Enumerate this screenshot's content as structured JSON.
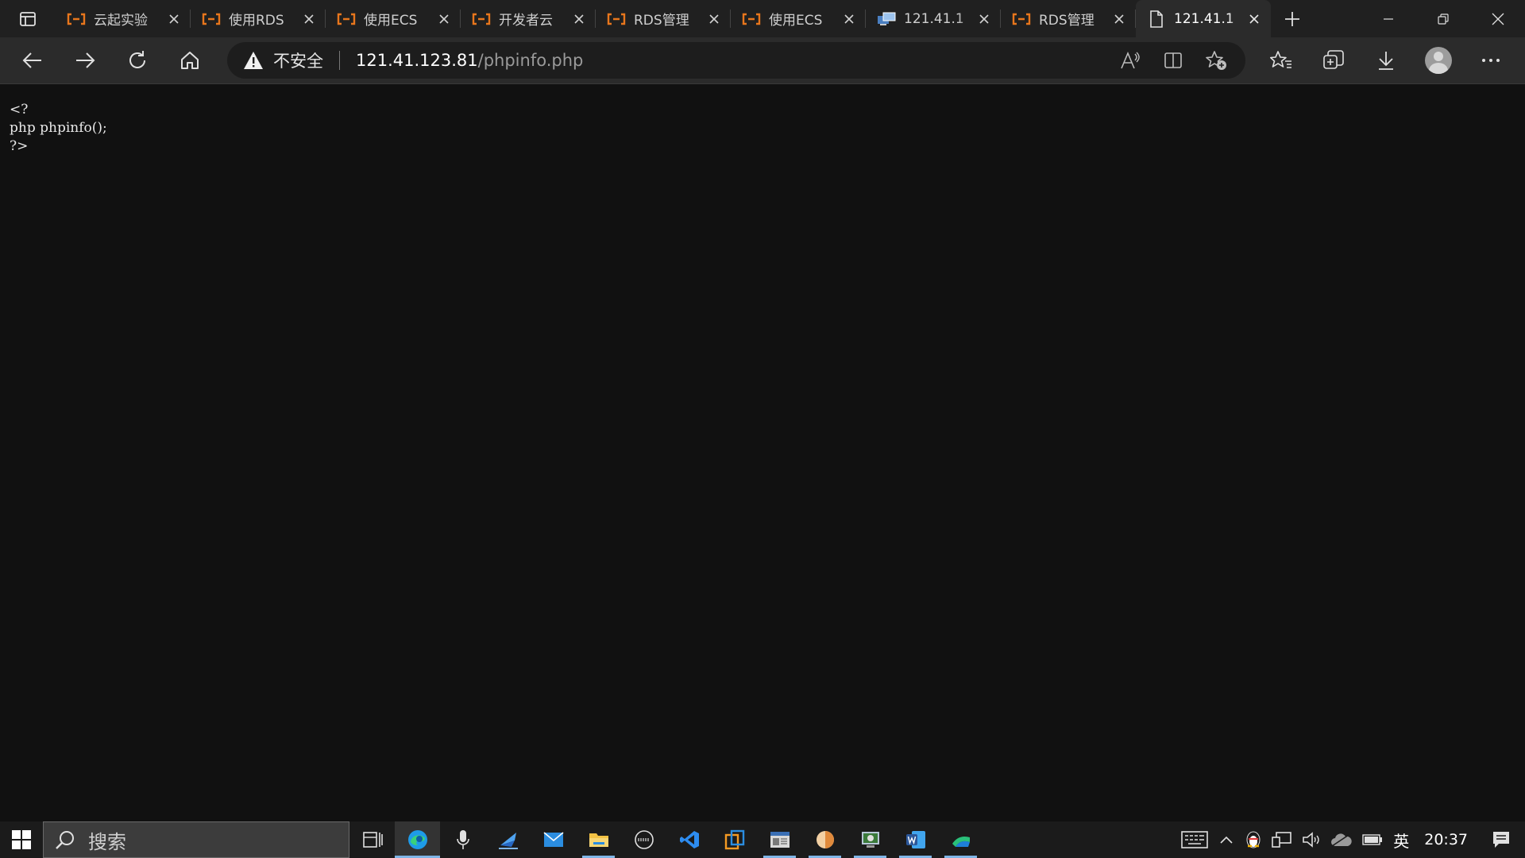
{
  "tabs": [
    {
      "title": "云起实验",
      "icon": "cloud-bracket-icon",
      "active": false
    },
    {
      "title": "使用RDS",
      "icon": "cloud-bracket-icon",
      "active": false
    },
    {
      "title": "使用ECS",
      "icon": "cloud-bracket-icon",
      "active": false
    },
    {
      "title": "开发者云",
      "icon": "cloud-bracket-icon",
      "active": false
    },
    {
      "title": "RDS管理",
      "icon": "cloud-bracket-icon",
      "active": false
    },
    {
      "title": "使用ECS",
      "icon": "cloud-bracket-icon",
      "active": false
    },
    {
      "title": "121.41.1",
      "icon": "remote-desktop-icon",
      "active": false
    },
    {
      "title": "RDS管理",
      "icon": "cloud-bracket-icon",
      "active": false
    },
    {
      "title": "121.41.1",
      "icon": "page-icon",
      "active": true
    }
  ],
  "address": {
    "security_label": "不安全",
    "host": "121.41.123.81",
    "path": "/phpinfo.php"
  },
  "content": {
    "lines": [
      "<?",
      "php phpinfo();",
      "?>"
    ]
  },
  "taskbar": {
    "search_label": "搜索",
    "apps": [
      {
        "name": "task-view",
        "icon": "task-view-icon"
      },
      {
        "name": "edge",
        "icon": "edge-icon",
        "running": true,
        "active": true
      },
      {
        "name": "voice",
        "icon": "microphone-icon"
      },
      {
        "name": "feedback",
        "icon": "feedback-icon"
      },
      {
        "name": "mail",
        "icon": "mail-icon"
      },
      {
        "name": "explorer",
        "icon": "folder-icon",
        "running": true
      },
      {
        "name": "dell",
        "icon": "dell-icon"
      },
      {
        "name": "vscode",
        "icon": "vscode-icon"
      },
      {
        "name": "app-orange",
        "icon": "copy-app-icon"
      },
      {
        "name": "app-window",
        "icon": "window-app-icon",
        "running": true
      },
      {
        "name": "app-circle",
        "icon": "circle-app-icon",
        "running": true
      },
      {
        "name": "app-remote",
        "icon": "remote-app-icon",
        "running": true
      },
      {
        "name": "word",
        "icon": "word-icon",
        "running": true
      },
      {
        "name": "app-wave",
        "icon": "wave-app-icon",
        "running": true
      }
    ],
    "ime_label": "英",
    "time": "20:37"
  },
  "colors": {
    "accent_orange": "#e8761c",
    "word_blue": "#2b579a",
    "edge_blue": "#1e9be8",
    "vscode_blue": "#2d8cf0"
  }
}
